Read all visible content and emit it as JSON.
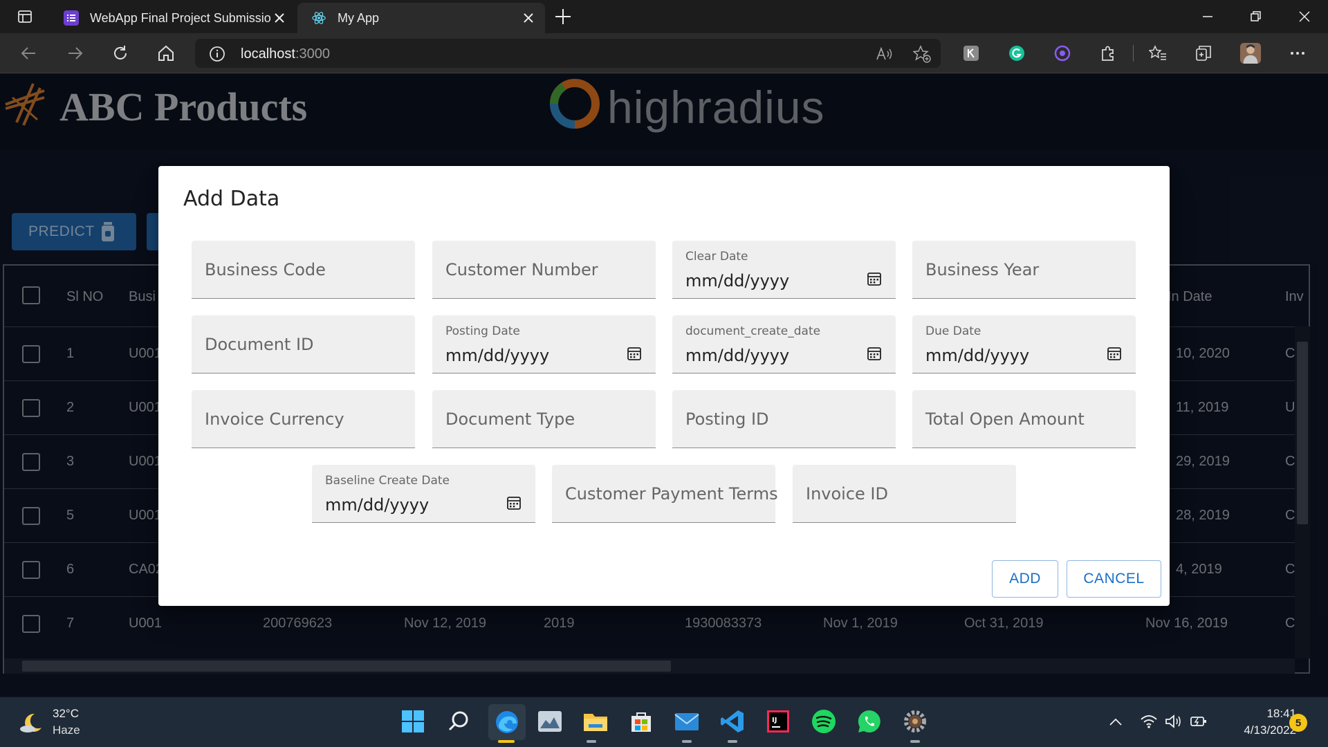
{
  "browser": {
    "tabs": [
      {
        "title": "WebApp Final Project Submissio",
        "active": false
      },
      {
        "title": "My App",
        "active": true
      }
    ],
    "address": {
      "host": "localhost",
      "port": ":3000"
    }
  },
  "app": {
    "brand_title": "ABC Products",
    "partner_logo_text": "highradius",
    "predict_label": "PREDICT",
    "table": {
      "headers": [
        "Sl NO",
        "Busi",
        "In Date",
        "Inv"
      ],
      "rows": [
        {
          "sl": "1",
          "code": "U001",
          "in_date": "10, 2020",
          "inv": "C"
        },
        {
          "sl": "2",
          "code": "U001",
          "in_date": "11, 2019",
          "inv": "U"
        },
        {
          "sl": "3",
          "code": "U001",
          "in_date": "29, 2019",
          "inv": "C"
        },
        {
          "sl": "5",
          "code": "U001",
          "in_date": "28, 2019",
          "inv": "C"
        },
        {
          "sl": "6",
          "code": "CA02",
          "in_date": "4, 2019",
          "inv": "C"
        },
        {
          "sl": "7",
          "code": "U001",
          "cust": "200769623",
          "d1": "Nov 12, 2019",
          "yr": "2019",
          "doc": "1930083373",
          "d2": "Nov 1, 2019",
          "d3": "Oct 31, 2019",
          "in_date": "Nov 16, 2019",
          "inv": "C"
        }
      ]
    }
  },
  "dialog": {
    "title": "Add Data",
    "fields": {
      "business_code": "Business Code",
      "customer_number": "Customer Number",
      "clear_date": {
        "label": "Clear Date",
        "value": "mm/dd/yyyy"
      },
      "business_year": "Business Year",
      "document_id": "Document ID",
      "posting_date": {
        "label": "Posting Date",
        "value": "mm/dd/yyyy"
      },
      "document_create_date": {
        "label": "document_create_date",
        "value": "mm/dd/yyyy"
      },
      "due_date": {
        "label": "Due Date",
        "value": "mm/dd/yyyy"
      },
      "invoice_currency": "Invoice Currency",
      "document_type": "Document Type",
      "posting_id": "Posting ID",
      "total_open_amount": "Total Open Amount",
      "baseline_create_date": {
        "label": "Baseline Create Date",
        "value": "mm/dd/yyyy"
      },
      "customer_payment_terms": "Customer Payment Terms",
      "invoice_id": "Invoice ID"
    },
    "add_label": "ADD",
    "cancel_label": "CANCEL"
  },
  "taskbar": {
    "weather_temp": "32°C",
    "weather_desc": "Haze",
    "time": "18:41",
    "date": "4/13/2022",
    "notification_count": "5"
  },
  "colors": {
    "accent": "#1c6fc6",
    "predict_bg": "#1f5f9f",
    "page_bg": "#0d1423"
  }
}
